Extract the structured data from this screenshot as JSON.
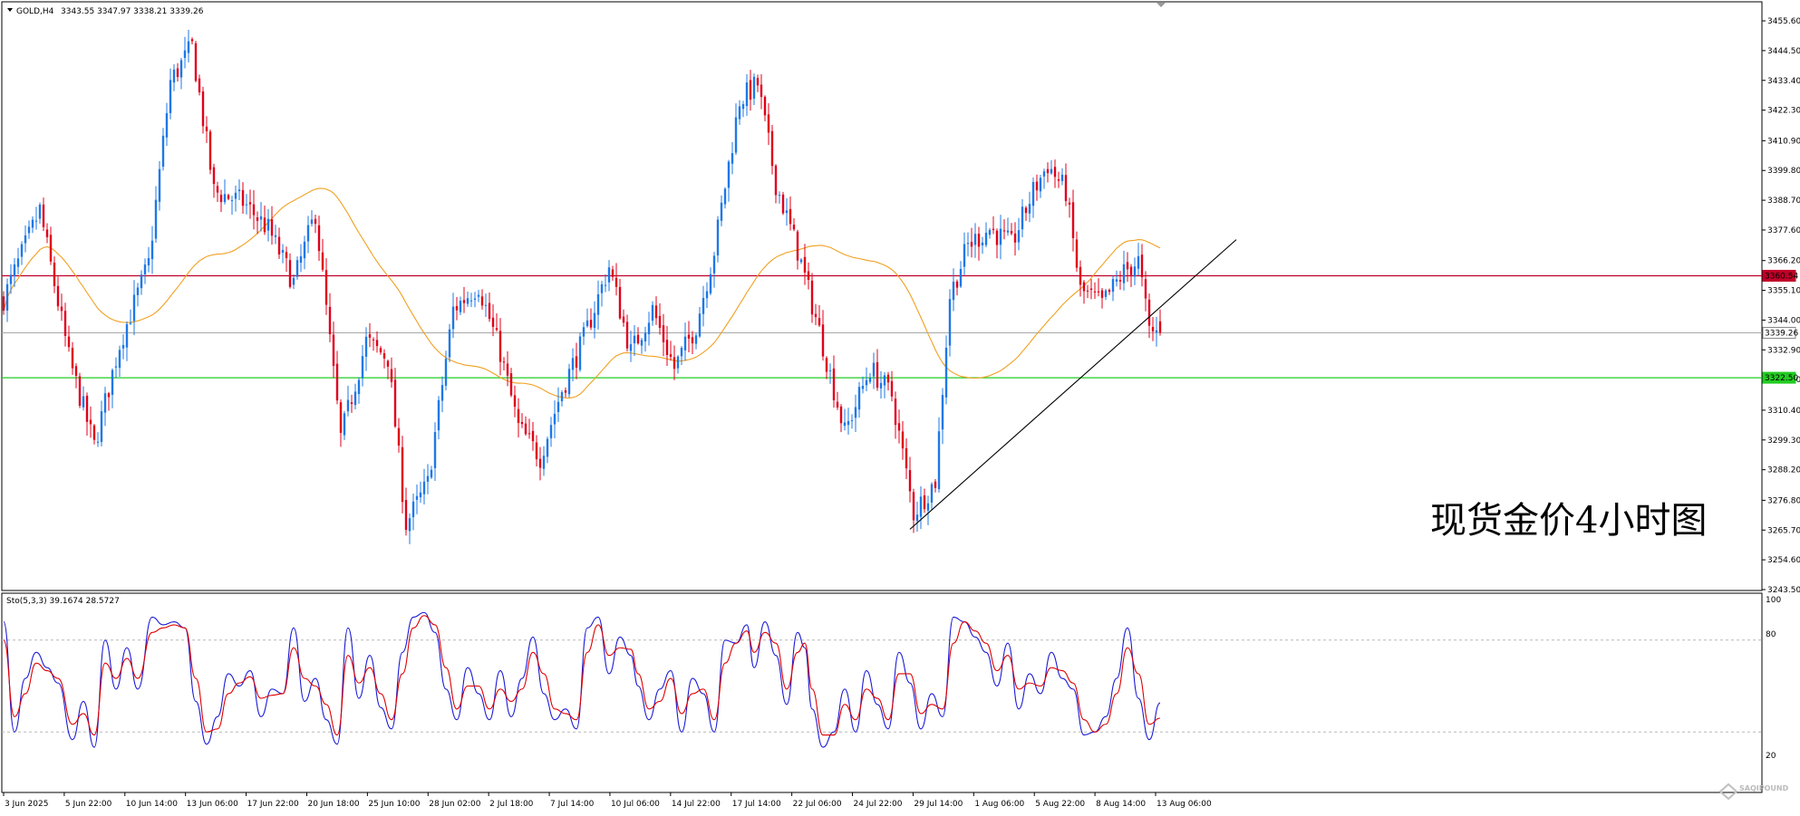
{
  "header": {
    "symbol": "GOLD,H4",
    "ohlc": "3343.55 3347.97 3338.21 3339.26"
  },
  "indicator": {
    "label": "Sto(5,3,3) 39.1674 28.5727",
    "scale": [
      "100",
      "80",
      "20"
    ]
  },
  "annotation": "现货金价4小时图",
  "watermark": "SAQIPOUND",
  "colors": {
    "bull": "#1e78e6",
    "bear": "#e0001a",
    "ma": "#f0a020",
    "resistance": "#c00028",
    "support": "#22cc22",
    "current": "#a8a8a8",
    "trendline": "#000000",
    "stoch_main": "#1a1ad6",
    "stoch_signal": "#e00000"
  },
  "chart_data": [
    {
      "type": "candlestick",
      "title": "GOLD,H4",
      "y_ticks": [
        "3455.60",
        "3444.50",
        "3433.40",
        "3422.30",
        "3410.90",
        "3399.80",
        "3388.70",
        "3377.60",
        "3366.20",
        "3355.10",
        "3344.00",
        "3332.90",
        "3321.80",
        "3310.40",
        "3299.30",
        "3288.20",
        "3276.80",
        "3265.70",
        "3254.60",
        "3243.50"
      ],
      "ylim": [
        3243.5,
        3460
      ],
      "x_ticks": [
        "3 Jun 2025",
        "5 Jun 22:00",
        "10 Jun 14:00",
        "13 Jun 06:00",
        "17 Jun 22:00",
        "20 Jun 18:00",
        "25 Jun 10:00",
        "28 Jun 02:00",
        "2 Jul 18:00",
        "7 Jul 14:00",
        "10 Jul 06:00",
        "14 Jul 22:00",
        "17 Jul 14:00",
        "22 Jul 06:00",
        "24 Jul 22:00",
        "29 Jul 14:00",
        "1 Aug 06:00",
        "5 Aug 22:00",
        "8 Aug 14:00",
        "13 Aug 06:00"
      ],
      "path_points": [
        {
          "i": 0,
          "p": 3352
        },
        {
          "i": 10,
          "p": 3385
        },
        {
          "i": 18,
          "p": 3330
        },
        {
          "i": 25,
          "p": 3297
        },
        {
          "i": 32,
          "p": 3335
        },
        {
          "i": 40,
          "p": 3365
        },
        {
          "i": 46,
          "p": 3433
        },
        {
          "i": 52,
          "p": 3446
        },
        {
          "i": 58,
          "p": 3392
        },
        {
          "i": 66,
          "p": 3388
        },
        {
          "i": 73,
          "p": 3378
        },
        {
          "i": 80,
          "p": 3358
        },
        {
          "i": 86,
          "p": 3384
        },
        {
          "i": 93,
          "p": 3300
        },
        {
          "i": 100,
          "p": 3336
        },
        {
          "i": 106,
          "p": 3330
        },
        {
          "i": 111,
          "p": 3268
        },
        {
          "i": 117,
          "p": 3283
        },
        {
          "i": 124,
          "p": 3348
        },
        {
          "i": 131,
          "p": 3357
        },
        {
          "i": 137,
          "p": 3332
        },
        {
          "i": 142,
          "p": 3304
        },
        {
          "i": 148,
          "p": 3293
        },
        {
          "i": 154,
          "p": 3318
        },
        {
          "i": 160,
          "p": 3337
        },
        {
          "i": 167,
          "p": 3364
        },
        {
          "i": 173,
          "p": 3332
        },
        {
          "i": 179,
          "p": 3348
        },
        {
          "i": 185,
          "p": 3326
        },
        {
          "i": 191,
          "p": 3342
        },
        {
          "i": 196,
          "p": 3370
        },
        {
          "i": 203,
          "p": 3426
        },
        {
          "i": 208,
          "p": 3432
        },
        {
          "i": 213,
          "p": 3395
        },
        {
          "i": 219,
          "p": 3370
        },
        {
          "i": 225,
          "p": 3340
        },
        {
          "i": 232,
          "p": 3302
        },
        {
          "i": 239,
          "p": 3326
        },
        {
          "i": 245,
          "p": 3316
        },
        {
          "i": 251,
          "p": 3272
        },
        {
          "i": 257,
          "p": 3284
        },
        {
          "i": 261,
          "p": 3353
        },
        {
          "i": 266,
          "p": 3372
        },
        {
          "i": 272,
          "p": 3378
        },
        {
          "i": 278,
          "p": 3372
        },
        {
          "i": 284,
          "p": 3392
        },
        {
          "i": 288,
          "p": 3402
        },
        {
          "i": 293,
          "p": 3392
        },
        {
          "i": 297,
          "p": 3355
        },
        {
          "i": 303,
          "p": 3350
        },
        {
          "i": 309,
          "p": 3362
        },
        {
          "i": 313,
          "p": 3366
        },
        {
          "i": 316,
          "p": 3340
        },
        {
          "i": 319,
          "p": 3339
        }
      ],
      "horizontal_levels": [
        {
          "price": 3360.54,
          "label": "3360.54",
          "role": "resistance"
        },
        {
          "price": 3339.26,
          "label": "3339.26",
          "role": "current"
        },
        {
          "price": 3322.5,
          "label": "3322.50",
          "role": "support"
        }
      ],
      "trendline": {
        "from": {
          "i": 250,
          "p": 3266
        },
        "to": {
          "i": 340,
          "p": 3374
        }
      },
      "overlay_ma": {
        "period": 50
      }
    },
    {
      "type": "line",
      "title": "Sto(5,3,3) 39.1674 28.5727",
      "ylim": [
        0,
        100
      ],
      "levels": [
        20,
        80
      ],
      "series": [
        {
          "key": "main",
          "points": [
            [
              0,
              92
            ],
            [
              3,
              20
            ],
            [
              6,
              55
            ],
            [
              9,
              72
            ],
            [
              12,
              62
            ],
            [
              15,
              52
            ],
            [
              19,
              15
            ],
            [
              22,
              40
            ],
            [
              25,
              10
            ],
            [
              28,
              80
            ],
            [
              31,
              48
            ],
            [
              34,
              75
            ],
            [
              37,
              48
            ],
            [
              41,
              95
            ],
            [
              44,
              90
            ],
            [
              47,
              92
            ],
            [
              50,
              88
            ],
            [
              53,
              40
            ],
            [
              56,
              12
            ],
            [
              59,
              30
            ],
            [
              62,
              58
            ],
            [
              65,
              50
            ],
            [
              68,
              60
            ],
            [
              71,
              30
            ],
            [
              74,
              48
            ],
            [
              77,
              45
            ],
            [
              80,
              88
            ],
            [
              83,
              40
            ],
            [
              86,
              55
            ],
            [
              89,
              28
            ],
            [
              92,
              12
            ],
            [
              95,
              88
            ],
            [
              98,
              42
            ],
            [
              101,
              70
            ],
            [
              104,
              36
            ],
            [
              107,
              22
            ],
            [
              110,
              72
            ],
            [
              113,
              95
            ],
            [
              116,
              98
            ],
            [
              119,
              85
            ],
            [
              122,
              48
            ],
            [
              125,
              28
            ],
            [
              128,
              62
            ],
            [
              131,
              45
            ],
            [
              134,
              28
            ],
            [
              137,
              60
            ],
            [
              140,
              30
            ],
            [
              143,
              55
            ],
            [
              146,
              82
            ],
            [
              149,
              45
            ],
            [
              152,
              28
            ],
            [
              155,
              35
            ],
            [
              158,
              22
            ],
            [
              161,
              88
            ],
            [
              164,
              95
            ],
            [
              167,
              58
            ],
            [
              170,
              82
            ],
            [
              173,
              70
            ],
            [
              175,
              50
            ],
            [
              178,
              28
            ],
            [
              181,
              48
            ],
            [
              184,
              60
            ],
            [
              187,
              20
            ],
            [
              190,
              55
            ],
            [
              193,
              45
            ],
            [
              196,
              20
            ],
            [
              199,
              80
            ],
            [
              202,
              78
            ],
            [
              205,
              90
            ],
            [
              207,
              62
            ],
            [
              210,
              92
            ],
            [
              213,
              70
            ],
            [
              216,
              38
            ],
            [
              219,
              85
            ],
            [
              221,
              75
            ],
            [
              223,
              35
            ],
            [
              226,
              10
            ],
            [
              229,
              20
            ],
            [
              232,
              48
            ],
            [
              235,
              20
            ],
            [
              238,
              60
            ],
            [
              241,
              38
            ],
            [
              244,
              22
            ],
            [
              247,
              72
            ],
            [
              250,
              52
            ],
            [
              253,
              22
            ],
            [
              256,
              45
            ],
            [
              259,
              30
            ],
            [
              262,
              95
            ],
            [
              265,
              92
            ],
            [
              268,
              82
            ],
            [
              271,
              72
            ],
            [
              274,
              50
            ],
            [
              277,
              78
            ],
            [
              280,
              35
            ],
            [
              283,
              58
            ],
            [
              286,
              45
            ],
            [
              289,
              72
            ],
            [
              292,
              55
            ],
            [
              295,
              48
            ],
            [
              298,
              18
            ],
            [
              301,
              20
            ],
            [
              304,
              30
            ],
            [
              307,
              55
            ],
            [
              310,
              88
            ],
            [
              313,
              42
            ],
            [
              316,
              15
            ],
            [
              319,
              39
            ]
          ]
        },
        {
          "key": "signal",
          "points": [
            [
              0,
              80
            ],
            [
              3,
              30
            ],
            [
              6,
              45
            ],
            [
              9,
              65
            ],
            [
              12,
              60
            ],
            [
              15,
              55
            ],
            [
              19,
              25
            ],
            [
              22,
              32
            ],
            [
              25,
              18
            ],
            [
              28,
              65
            ],
            [
              31,
              55
            ],
            [
              34,
              68
            ],
            [
              37,
              55
            ],
            [
              41,
              85
            ],
            [
              44,
              88
            ],
            [
              47,
              90
            ],
            [
              50,
              88
            ],
            [
              53,
              55
            ],
            [
              56,
              20
            ],
            [
              59,
              22
            ],
            [
              62,
              45
            ],
            [
              65,
              52
            ],
            [
              68,
              56
            ],
            [
              71,
              42
            ],
            [
              74,
              44
            ],
            [
              77,
              45
            ],
            [
              80,
              75
            ],
            [
              83,
              55
            ],
            [
              86,
              50
            ],
            [
              89,
              38
            ],
            [
              92,
              18
            ],
            [
              95,
              70
            ],
            [
              98,
              52
            ],
            [
              101,
              62
            ],
            [
              104,
              45
            ],
            [
              107,
              28
            ],
            [
              110,
              58
            ],
            [
              113,
              88
            ],
            [
              116,
              96
            ],
            [
              119,
              90
            ],
            [
              122,
              62
            ],
            [
              125,
              35
            ],
            [
              128,
              50
            ],
            [
              131,
              50
            ],
            [
              134,
              35
            ],
            [
              137,
              48
            ],
            [
              140,
              40
            ],
            [
              143,
              48
            ],
            [
              146,
              72
            ],
            [
              149,
              58
            ],
            [
              152,
              35
            ],
            [
              155,
              32
            ],
            [
              158,
              28
            ],
            [
              161,
              72
            ],
            [
              164,
              90
            ],
            [
              167,
              70
            ],
            [
              170,
              75
            ],
            [
              173,
              74
            ],
            [
              175,
              58
            ],
            [
              178,
              35
            ],
            [
              181,
              40
            ],
            [
              184,
              55
            ],
            [
              187,
              32
            ],
            [
              190,
              45
            ],
            [
              193,
              48
            ],
            [
              196,
              28
            ],
            [
              199,
              65
            ],
            [
              202,
              78
            ],
            [
              205,
              86
            ],
            [
              207,
              72
            ],
            [
              210,
              85
            ],
            [
              213,
              78
            ],
            [
              216,
              48
            ],
            [
              219,
              72
            ],
            [
              221,
              78
            ],
            [
              223,
              48
            ],
            [
              226,
              18
            ],
            [
              229,
              18
            ],
            [
              232,
              38
            ],
            [
              235,
              28
            ],
            [
              238,
              48
            ],
            [
              241,
              42
            ],
            [
              244,
              28
            ],
            [
              247,
              58
            ],
            [
              250,
              58
            ],
            [
              253,
              32
            ],
            [
              256,
              38
            ],
            [
              259,
              35
            ],
            [
              262,
              78
            ],
            [
              265,
              92
            ],
            [
              268,
              86
            ],
            [
              271,
              78
            ],
            [
              274,
              60
            ],
            [
              277,
              70
            ],
            [
              280,
              48
            ],
            [
              283,
              52
            ],
            [
              286,
              50
            ],
            [
              289,
              62
            ],
            [
              292,
              60
            ],
            [
              295,
              52
            ],
            [
              298,
              28
            ],
            [
              301,
              20
            ],
            [
              304,
              25
            ],
            [
              307,
              45
            ],
            [
              310,
              75
            ],
            [
              313,
              58
            ],
            [
              316,
              25
            ],
            [
              319,
              29
            ]
          ]
        }
      ]
    }
  ]
}
